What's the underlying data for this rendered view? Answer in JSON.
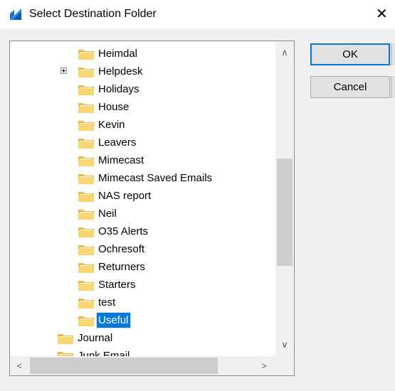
{
  "window": {
    "title": "Select Destination Folder",
    "close_glyph": "✕",
    "accent": "#0078d7"
  },
  "tree": {
    "items": [
      {
        "label": "Heimdal",
        "level": 2,
        "expandable": false,
        "selected": false
      },
      {
        "label": "Helpdesk",
        "level": 2,
        "expandable": true,
        "selected": false
      },
      {
        "label": "Holidays",
        "level": 2,
        "expandable": false,
        "selected": false
      },
      {
        "label": "House",
        "level": 2,
        "expandable": false,
        "selected": false
      },
      {
        "label": "Kevin",
        "level": 2,
        "expandable": false,
        "selected": false
      },
      {
        "label": "Leavers",
        "level": 2,
        "expandable": false,
        "selected": false
      },
      {
        "label": "Mimecast",
        "level": 2,
        "expandable": false,
        "selected": false
      },
      {
        "label": "Mimecast Saved Emails",
        "level": 2,
        "expandable": false,
        "selected": false
      },
      {
        "label": "NAS report",
        "level": 2,
        "expandable": false,
        "selected": false
      },
      {
        "label": "Neil",
        "level": 2,
        "expandable": false,
        "selected": false
      },
      {
        "label": "O35 Alerts",
        "level": 2,
        "expandable": false,
        "selected": false
      },
      {
        "label": "Ochresoft",
        "level": 2,
        "expandable": false,
        "selected": false
      },
      {
        "label": "Returners",
        "level": 2,
        "expandable": false,
        "selected": false
      },
      {
        "label": "Starters",
        "level": 2,
        "expandable": false,
        "selected": false
      },
      {
        "label": "test",
        "level": 2,
        "expandable": false,
        "selected": false
      },
      {
        "label": "Useful",
        "level": 2,
        "expandable": false,
        "selected": true
      },
      {
        "label": "Journal",
        "level": 1,
        "expandable": false,
        "selected": false
      },
      {
        "label": "Junk Email",
        "level": 1,
        "expandable": false,
        "selected": false
      }
    ]
  },
  "scroll": {
    "up": "∧",
    "down": "∨",
    "left": "<",
    "right": ">"
  },
  "buttons": {
    "ok": "OK",
    "cancel": "Cancel"
  }
}
